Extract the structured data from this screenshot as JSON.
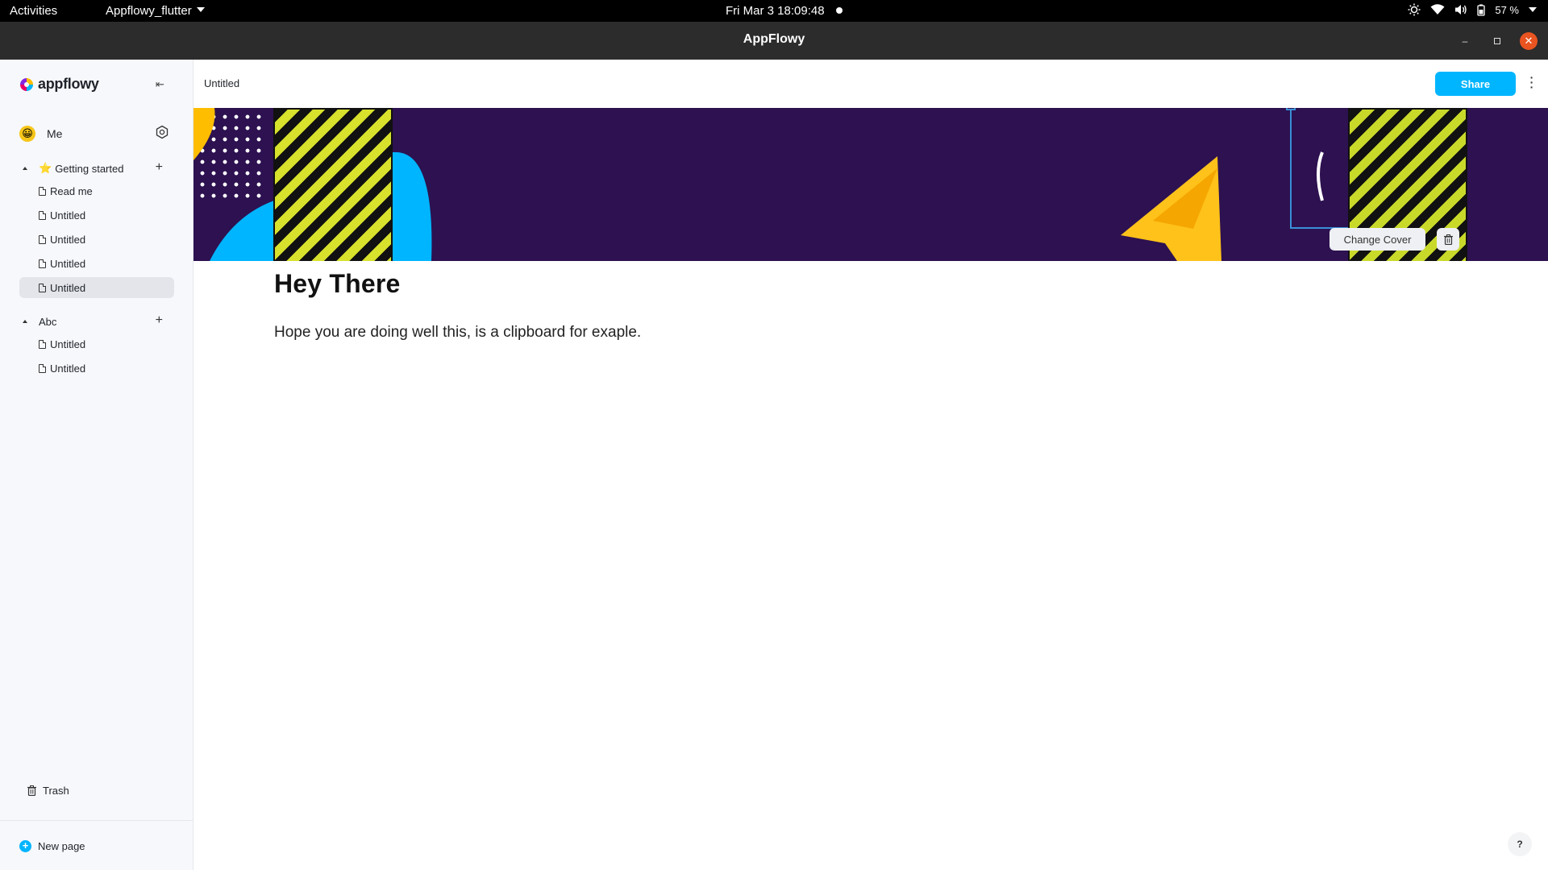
{
  "system_bar": {
    "activities": "Activities",
    "app_menu": "Appflowy_flutter",
    "clock": "Fri Mar 3  18:09:48",
    "battery": "57 %"
  },
  "window": {
    "title": "AppFlowy"
  },
  "sidebar": {
    "logo_text": "appflowy",
    "user_name": "Me",
    "sections": [
      {
        "label": "Getting started",
        "pages": [
          "Read me",
          "Untitled",
          "Untitled",
          "Untitled",
          "Untitled"
        ]
      },
      {
        "label": "Abc",
        "pages": [
          "Untitled",
          "Untitled"
        ]
      }
    ],
    "trash": "Trash",
    "new_page": "New page"
  },
  "header": {
    "breadcrumb": "Untitled",
    "share_label": "Share"
  },
  "cover": {
    "change_cover_label": "Change Cover"
  },
  "document": {
    "title": "Hey There",
    "body": "Hope you are doing well this, is a clipboard for exaple."
  },
  "help": {
    "label": "?"
  },
  "colors": {
    "accent": "#00b5ff",
    "cover_background": "#2d1150",
    "close_button": "#e95420"
  }
}
